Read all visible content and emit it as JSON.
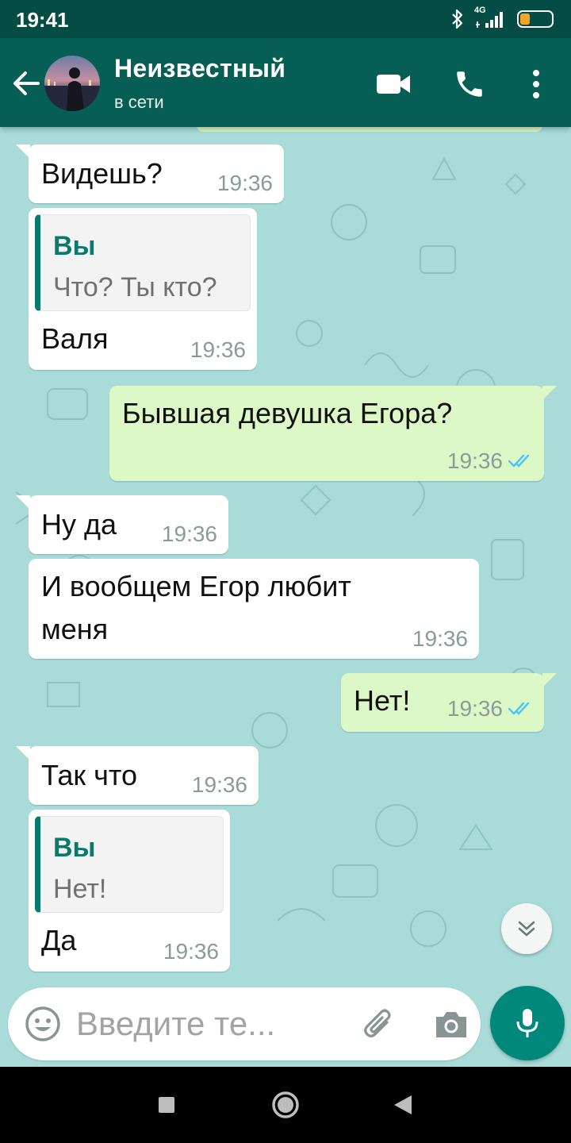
{
  "status_bar": {
    "time": "19:41",
    "network": "4G",
    "battery": "31",
    "battery_level": 0.31
  },
  "header": {
    "contact_name": "Неизвестный",
    "contact_status": "в сети",
    "icons": [
      "back-arrow-icon",
      "video-call-icon",
      "phone-icon",
      "more-vert-icon"
    ]
  },
  "messages": [
    {
      "direction": "in",
      "text": "Видешь?",
      "time": "19:36"
    },
    {
      "direction": "in",
      "reply_to": {
        "author": "Вы",
        "text": "Что? Ты кто?"
      },
      "text": "Валя",
      "time": "19:36"
    },
    {
      "direction": "out",
      "text": "Бывшая девушка Егора?",
      "time": "19:36",
      "status": "read"
    },
    {
      "direction": "in",
      "text": "Ну да",
      "time": "19:36"
    },
    {
      "direction": "in",
      "text_lines": [
        "И вообщем Егор любит",
        "меня"
      ],
      "time": "19:36"
    },
    {
      "direction": "out",
      "text": "Нет!",
      "time": "19:36",
      "status": "read"
    },
    {
      "direction": "in",
      "text": "Так что",
      "time": "19:36"
    },
    {
      "direction": "in",
      "reply_to": {
        "author": "Вы",
        "text": "Нет!"
      },
      "text": "Да",
      "time": "19:36"
    }
  ],
  "input": {
    "placeholder": "Введите те..."
  },
  "colors": {
    "header": "#075e54",
    "status_bar": "#054d44",
    "chat_background": "#a9dcd9",
    "outgoing_bubble": "#dcf8c6",
    "incoming_bubble": "#ffffff",
    "read_ticks": "#4fc3f7",
    "accent": "#00897b"
  }
}
